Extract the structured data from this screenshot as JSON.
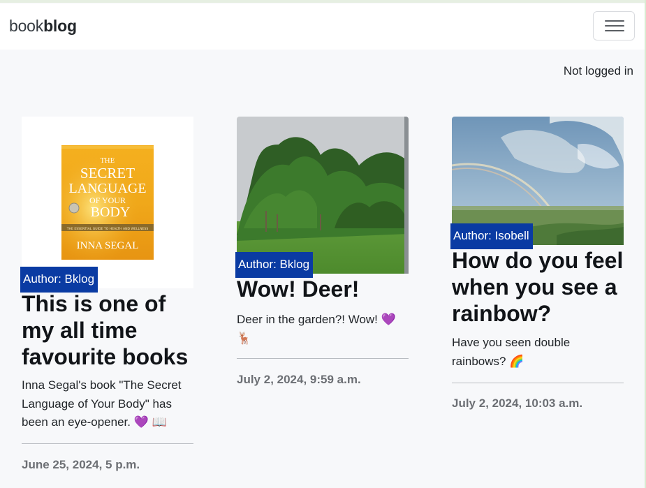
{
  "navbar": {
    "brand_light": "book",
    "brand_bold": "blog",
    "toggle_icon": "hamburger-menu-icon"
  },
  "auth": {
    "status": "Not logged in"
  },
  "posts": [
    {
      "image": "book-cover-secret-language-of-your-body",
      "cover": {
        "kicker": "THE",
        "line1": "SECRET",
        "line2": "LANGUAGE",
        "line3": "OF YOUR",
        "line4": "BODY",
        "strap": "THE ESSENTIAL GUIDE TO HEALTH AND WELLNESS",
        "author": "INNA SEGAL"
      },
      "author_badge": "Author: Bklog",
      "title": "This is one of my all time favourite books",
      "summary": "Inna Segal's book \"The Secret Language of Your Body\" has been an eye-opener. 💜 📖",
      "date": "June 25, 2024, 5 p.m."
    },
    {
      "image": "photo-trees-and-garden-lawn",
      "author_badge": "Author: Bklog",
      "title": "Wow! Deer!",
      "summary": "Deer in the garden?! Wow! 💜 🦌",
      "date": "July 2, 2024, 9:59 a.m."
    },
    {
      "image": "photo-rainbow-over-field",
      "author_badge": "Author: Isobell",
      "title": "How do you feel when you see a rainbow?",
      "summary": "Have you seen double rainbows? 🌈",
      "date": "July 2, 2024, 10:03 a.m."
    }
  ],
  "colors": {
    "badge_bg": "#0a3ba3",
    "page_bg": "#f7f8fa",
    "date_text": "#6c6f74"
  }
}
